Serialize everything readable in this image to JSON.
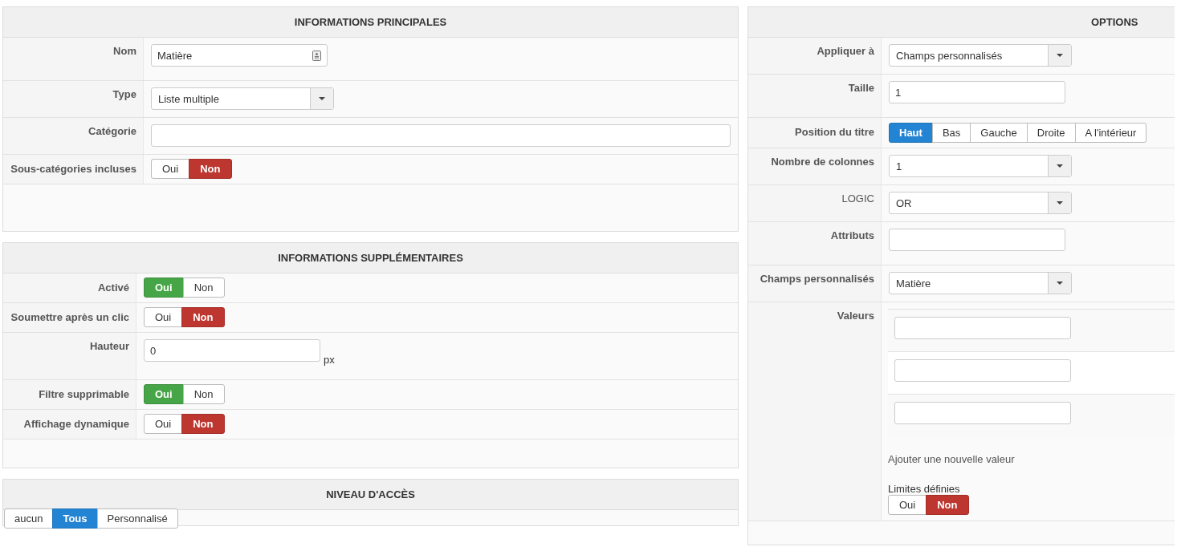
{
  "left_panels": [
    {
      "title": "INFORMATIONS PRINCIPALES",
      "rows": [
        {
          "label": "Nom",
          "kind": "text",
          "value": "Matière",
          "icon": true
        },
        {
          "label": "Type",
          "kind": "select",
          "value": "Liste multiple"
        },
        {
          "label": "Catégorie",
          "kind": "longtext"
        },
        {
          "label": "Sous-catégories incluses",
          "kind": "toggle",
          "options": [
            {
              "label": "Oui",
              "selected": false
            },
            {
              "label": "Non",
              "selected": true
            }
          ]
        }
      ]
    },
    {
      "title": "INFORMATIONS SUPPLÉMENTAIRES",
      "rows": [
        {
          "label": "Activé",
          "kind": "toggle",
          "options": [
            {
              "label": "Oui",
              "selected": true
            },
            {
              "label": "Non",
              "selected": false
            }
          ]
        },
        {
          "label": "Soumettre après un clic",
          "kind": "toggle",
          "options": [
            {
              "label": "Oui",
              "selected": false
            },
            {
              "label": "Non",
              "selected": true
            }
          ]
        },
        {
          "label": "Hauteur",
          "kind": "text",
          "value": "0",
          "unit": "px"
        },
        {
          "label": "Filtre supprimable",
          "kind": "toggle",
          "options": [
            {
              "label": "Oui",
              "selected": true
            },
            {
              "label": "Non",
              "selected": false
            }
          ]
        },
        {
          "label": "Affichage dynamique",
          "kind": "toggle",
          "options": [
            {
              "label": "Oui",
              "selected": false
            },
            {
              "label": "Non",
              "selected": true
            }
          ]
        }
      ]
    }
  ],
  "access": {
    "title": "NIVEAU D'ACCÈS",
    "options": [
      {
        "label": "aucun",
        "selected": false
      },
      {
        "label": "Tous",
        "selected": true
      },
      {
        "label": "Personnalisé",
        "selected": false
      }
    ]
  },
  "options_panel": {
    "title": "OPTIONS",
    "rows": [
      {
        "label": "Appliquer à",
        "kind": "select",
        "value": "Champs personnalisés"
      },
      {
        "label": "Taille",
        "kind": "text",
        "value": "1"
      },
      {
        "label": "Position du titre",
        "kind": "segmented",
        "options": [
          {
            "label": "Haut",
            "selected": true
          },
          {
            "label": "Bas",
            "selected": false
          },
          {
            "label": "Gauche",
            "selected": false
          },
          {
            "label": "Droite",
            "selected": false
          },
          {
            "label": "A l'intérieur",
            "selected": false
          }
        ]
      },
      {
        "label": "Nombre de colonnes",
        "kind": "select",
        "value": "1"
      },
      {
        "label": "LOGIC",
        "kind": "select",
        "value": "OR",
        "bold_label": false
      },
      {
        "label": "Attributs",
        "kind": "text"
      },
      {
        "label": "Champs personnalisés",
        "kind": "select",
        "value": "Matière"
      },
      {
        "label": "Valeurs",
        "kind": "values",
        "fields": [
          {
            "kind": "text"
          },
          {
            "kind": "text"
          },
          {
            "kind": "text"
          }
        ],
        "add_link": "Ajouter une nouvelle valeur",
        "limits": {
          "label": "Limites définies",
          "options": [
            {
              "label": "Oui",
              "selected": false
            },
            {
              "label": "Non",
              "selected": true
            }
          ]
        }
      }
    ]
  }
}
